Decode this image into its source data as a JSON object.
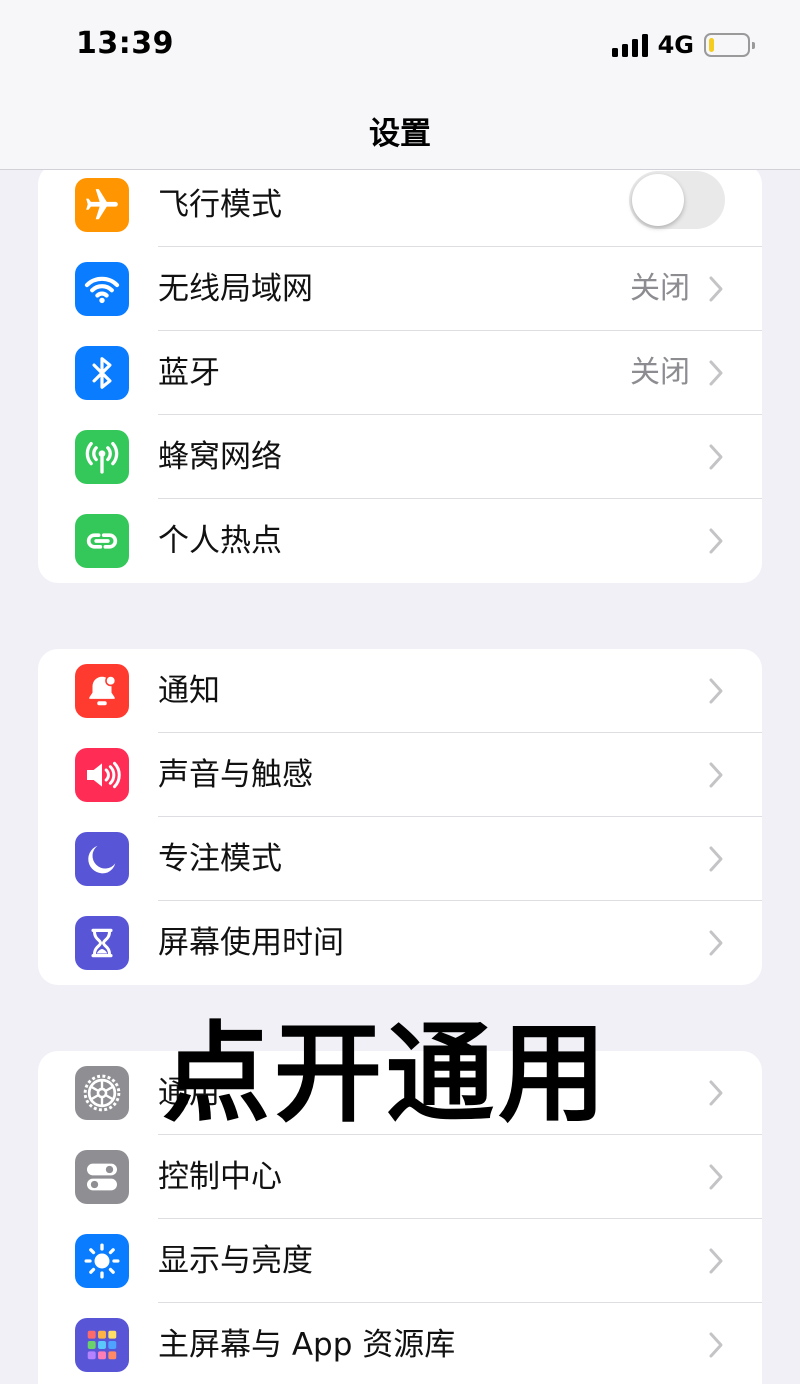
{
  "status_bar": {
    "time": "13:39",
    "network": "4G",
    "battery_level": 0.15,
    "battery_color": "#f4cd20"
  },
  "nav": {
    "title": "设置"
  },
  "groups": [
    {
      "items": [
        {
          "label": "飞行模式",
          "icon": "airplane-icon",
          "icon_bg": "#ff9500",
          "control": "toggle",
          "toggle_on": false
        },
        {
          "label": "无线局域网",
          "icon": "wifi-icon",
          "icon_bg": "#0a7cff",
          "value": "关闭"
        },
        {
          "label": "蓝牙",
          "icon": "bluetooth-icon",
          "icon_bg": "#0a7cff",
          "value": "关闭"
        },
        {
          "label": "蜂窝网络",
          "icon": "cellular-icon",
          "icon_bg": "#34c759"
        },
        {
          "label": "个人热点",
          "icon": "hotspot-icon",
          "icon_bg": "#34c759"
        }
      ]
    },
    {
      "items": [
        {
          "label": "通知",
          "icon": "bell-icon",
          "icon_bg": "#ff3b30"
        },
        {
          "label": "声音与触感",
          "icon": "speaker-icon",
          "icon_bg": "#ff2d55"
        },
        {
          "label": "专注模式",
          "icon": "moon-icon",
          "icon_bg": "#5856d6"
        },
        {
          "label": "屏幕使用时间",
          "icon": "hourglass-icon",
          "icon_bg": "#5856d6"
        }
      ]
    },
    {
      "items": [
        {
          "label": "通用",
          "icon": "gear-icon",
          "icon_bg": "#8e8e93"
        },
        {
          "label": "控制中心",
          "icon": "switches-icon",
          "icon_bg": "#8e8e93"
        },
        {
          "label": "显示与亮度",
          "icon": "sun-icon",
          "icon_bg": "#0a7cff"
        },
        {
          "label": "主屏幕与 App 资源库",
          "icon": "app-grid-icon",
          "icon_bg": "#5856d6"
        }
      ]
    }
  ],
  "overlay_text": "点开通用"
}
